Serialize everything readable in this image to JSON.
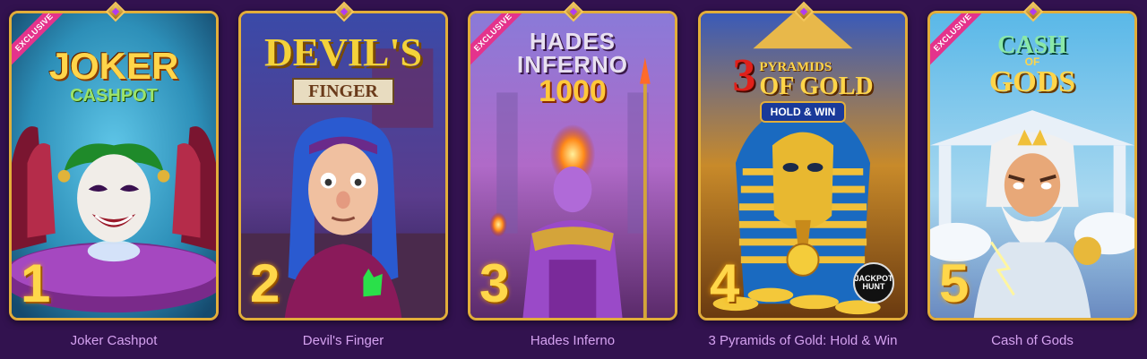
{
  "ribbon_text": "EXCLUSIVE",
  "colors": {
    "background": "#32124f",
    "frame": "#e2ae3a",
    "caption": "#d5a2f0",
    "rank": "#ffd74a",
    "ribbon": "#e4338c"
  },
  "games": [
    {
      "rank": "1",
      "caption": "Joker Cashpot",
      "logo_line1": "JOKER",
      "logo_line2": "CASHPOT",
      "exclusive": true,
      "theme_icon": "joker-icon"
    },
    {
      "rank": "2",
      "caption": "Devil's Finger",
      "logo_line1": "DEVIL'S",
      "logo_line2": "FINGER",
      "exclusive": false,
      "theme_icon": "goth-character-icon"
    },
    {
      "rank": "3",
      "caption": "Hades Inferno",
      "logo_line1": "HADES",
      "logo_line2": "INFERNO",
      "logo_line3": "1000",
      "exclusive": true,
      "theme_icon": "hades-god-icon"
    },
    {
      "rank": "4",
      "caption": "3 Pyramids of Gold: Hold & Win",
      "logo_line1": "3",
      "logo_line2": "PYRAMIDS",
      "logo_line3": "OF GOLD",
      "logo_line4": "HOLD & WIN",
      "badge_line1": "JACKPOT",
      "badge_line2": "HUNT",
      "exclusive": false,
      "theme_icon": "pharaoh-icon"
    },
    {
      "rank": "5",
      "caption": "Cash of Gods",
      "logo_line1": "CASH",
      "logo_line2": "OF",
      "logo_line3": "GODS",
      "exclusive": true,
      "theme_icon": "zeus-icon"
    }
  ]
}
